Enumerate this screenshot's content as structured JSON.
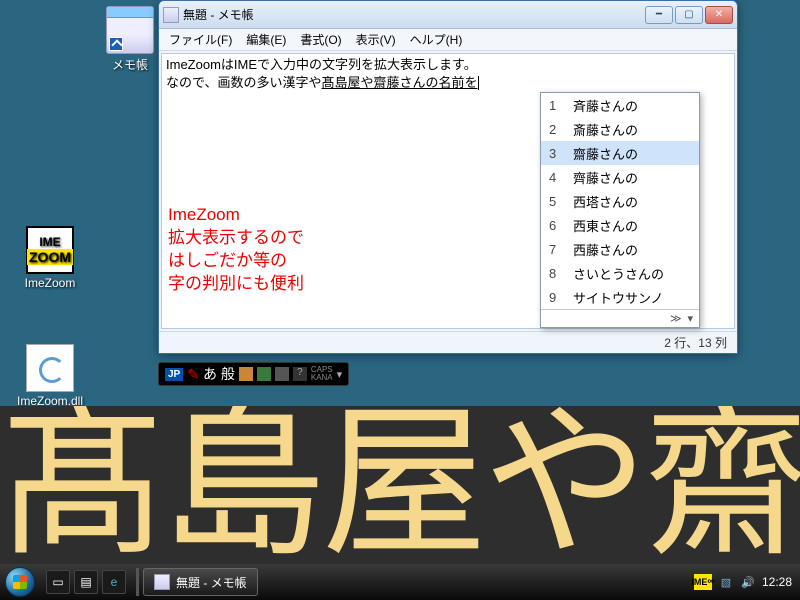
{
  "desktop": {
    "icons": [
      {
        "label": "メモ帳",
        "kind": "notepad"
      },
      {
        "label": "ImeZoom",
        "kind": "imezoom"
      },
      {
        "label": "ImeZoom.dll",
        "kind": "dll"
      }
    ]
  },
  "window": {
    "title": "無題 - メモ帳",
    "menu": [
      "ファイル(F)",
      "編集(E)",
      "書式(O)",
      "表示(V)",
      "ヘルプ(H)"
    ],
    "line1": "ImeZoomはIMEで入力中の文字列を拡大表示します。",
    "line2_prefix": "なので、画数の多い漢字や",
    "line2_underlined": "髙島屋や齋藤さんの名前を",
    "promo": [
      "ImeZoom",
      "拡大表示するので",
      "はしごだか等の",
      "字の判別にも便利"
    ],
    "status": "2 行、13 列"
  },
  "ime_popup": {
    "items": [
      {
        "n": "1",
        "text": "斉藤さんの"
      },
      {
        "n": "2",
        "text": "斎藤さんの"
      },
      {
        "n": "3",
        "text": "齋藤さんの"
      },
      {
        "n": "4",
        "text": "齊藤さんの"
      },
      {
        "n": "5",
        "text": "西塔さんの"
      },
      {
        "n": "6",
        "text": "西東さんの"
      },
      {
        "n": "7",
        "text": "西藤さんの"
      },
      {
        "n": "8",
        "text": "さいとうさんの"
      },
      {
        "n": "9",
        "text": "サイトウサンノ"
      }
    ],
    "selected_index": 2,
    "more_glyph": "≫",
    "scroll_glyph": "▾"
  },
  "lang_bar": {
    "jp": "JP",
    "mode": "あ 般",
    "caps1": "CAPS",
    "caps2": "KANA"
  },
  "zoom_overlay": {
    "text": "髙島屋や齋"
  },
  "taskbar": {
    "task_label": "無題 - メモ帳",
    "ime_tray": "IME",
    "clock": "12:28"
  }
}
